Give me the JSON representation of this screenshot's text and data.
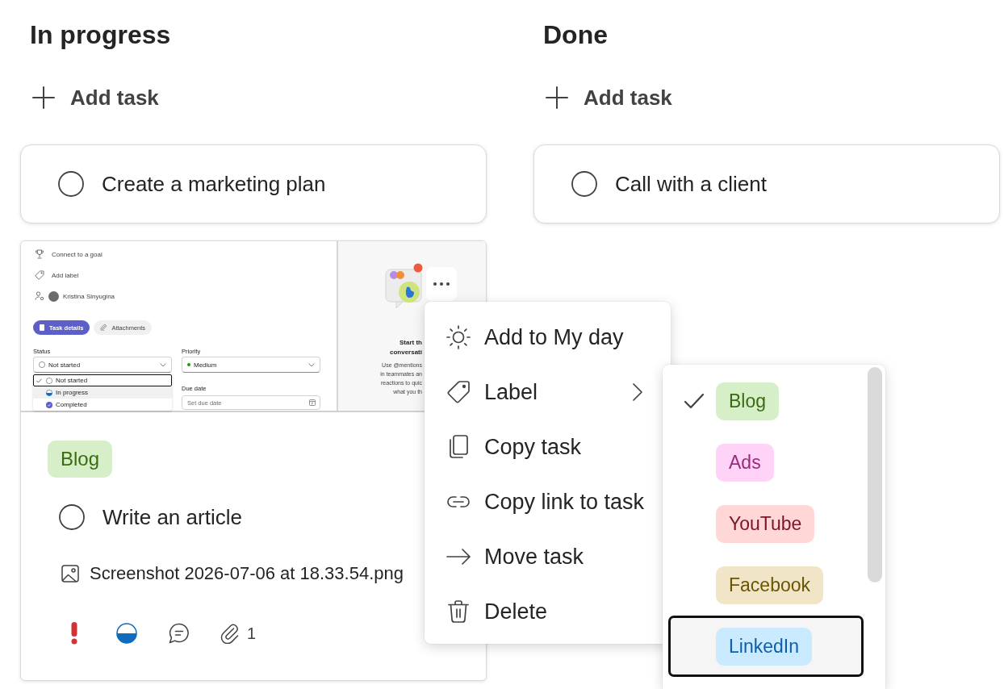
{
  "columns": [
    {
      "title": "In progress",
      "add_task": "Add task",
      "tasks": [
        {
          "kind": "simple",
          "title": "Create a marketing plan",
          "completed": false
        },
        {
          "kind": "detailed",
          "title": "Write an article",
          "completed": false,
          "label": {
            "text": "Blog",
            "color": "#3b6b10"
          },
          "attachment": "Screenshot 2026-07-06 at 18.33.54.png",
          "indicators": [
            {
              "kind": "important"
            },
            {
              "kind": "in_progress"
            },
            {
              "kind": "comments"
            },
            {
              "kind": "attachments",
              "count": "1"
            }
          ],
          "preview": {
            "details": [
              "Connect to a goal",
              "Add label"
            ],
            "assignee": "Kristina Sinyugina",
            "tabs": [
              {
                "label": "Task details",
                "selected": true
              },
              {
                "label": "Attachments",
                "selected": false
              }
            ],
            "status": {
              "label": "Status",
              "value": {
                "text": "Not started",
                "kind": "not_started"
              },
              "options": [
                {
                  "label": "Not started",
                  "kind": "not_started",
                  "selected": true,
                  "focused": true,
                  "hovered": false
                },
                {
                  "label": "In progress",
                  "kind": "in_progress",
                  "selected": false,
                  "focused": false,
                  "hovered": true
                },
                {
                  "label": "Completed",
                  "kind": "completed",
                  "selected": false,
                  "focused": false,
                  "hovered": false
                }
              ]
            },
            "priority": {
              "label": "Priority",
              "value": "Medium",
              "color": "#13a10e"
            },
            "due_date": {
              "label": "Due date",
              "placeholder": "Set due date"
            },
            "conversation": {
              "title_lines": [
                "Start th",
                "conversati"
              ],
              "body_lines": [
                "Use @mentions",
                "in teammates an",
                "reactions to quic",
                "what you th"
              ]
            }
          }
        }
      ]
    },
    {
      "title": "Done",
      "add_task": "Add task",
      "tasks": [
        {
          "kind": "simple",
          "title": "Call with a client",
          "completed": false
        }
      ]
    }
  ],
  "context_menu": {
    "items": [
      {
        "label": "Add to My day",
        "submenu": false
      },
      {
        "label": "Label",
        "submenu": true
      },
      {
        "label": "Copy task",
        "submenu": false
      },
      {
        "label": "Copy link to task",
        "submenu": false
      },
      {
        "label": "Move task",
        "submenu": false
      },
      {
        "label": "Delete",
        "submenu": false
      }
    ]
  },
  "label_menu": {
    "items": [
      {
        "text": "Blog",
        "color": "#3b6b10",
        "selected": true,
        "focused": false
      },
      {
        "text": "Ads",
        "color": "#9b2a7e",
        "selected": false,
        "focused": false
      },
      {
        "text": "YouTube",
        "color": "#7c1426",
        "selected": false,
        "focused": false
      },
      {
        "text": "Facebook",
        "color": "#6b5500",
        "selected": false,
        "focused": false
      },
      {
        "text": "LinkedIn",
        "color": "#0f5ea8",
        "selected": false,
        "focused": true
      }
    ]
  }
}
